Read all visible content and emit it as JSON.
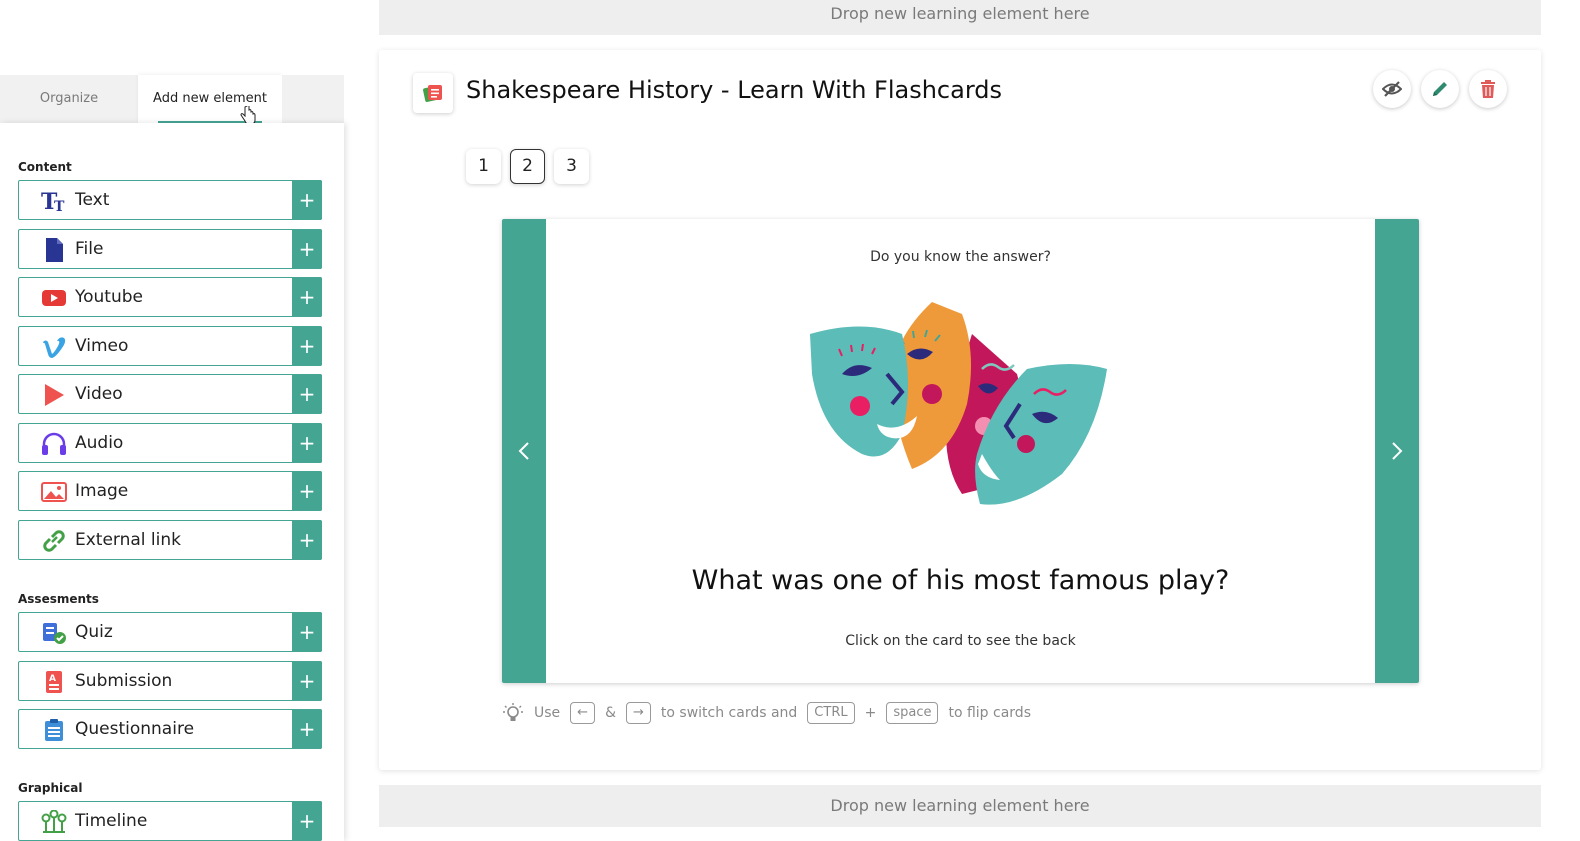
{
  "sidebar": {
    "tabs": [
      {
        "label": "Organize"
      },
      {
        "label": "Add new element"
      }
    ],
    "sections": {
      "content": {
        "title": "Content",
        "items": [
          {
            "label": "Text",
            "icon": "text-icon"
          },
          {
            "label": "File",
            "icon": "file-icon"
          },
          {
            "label": "Youtube",
            "icon": "youtube-icon"
          },
          {
            "label": "Vimeo",
            "icon": "vimeo-icon"
          },
          {
            "label": "Video",
            "icon": "video-icon"
          },
          {
            "label": "Audio",
            "icon": "headphones-icon"
          },
          {
            "label": "Image",
            "icon": "image-icon"
          },
          {
            "label": "External link",
            "icon": "link-icon"
          }
        ]
      },
      "assessments": {
        "title": "Assesments",
        "items": [
          {
            "label": "Quiz",
            "icon": "quiz-icon"
          },
          {
            "label": "Submission",
            "icon": "submission-icon"
          },
          {
            "label": "Questionnaire",
            "icon": "clipboard-icon"
          }
        ]
      },
      "graphical": {
        "title": "Graphical",
        "items": [
          {
            "label": "Timeline",
            "icon": "timeline-icon"
          }
        ]
      }
    },
    "add_symbol": "+"
  },
  "drop_zone": {
    "label": "Drop new learning element here"
  },
  "element": {
    "title": "Shakespeare History - Learn With Flashcards",
    "icon": "flashcards-icon",
    "actions": [
      "eye-off-icon",
      "pencil-icon",
      "trash-icon"
    ]
  },
  "pagination": {
    "pages": [
      "1",
      "2",
      "3"
    ],
    "current": "2"
  },
  "flashcard": {
    "prompt": "Do you know the answer?",
    "question": "What was one of his most famous play?",
    "hint": "Click on the card to see the back",
    "image": "theatre-masks-illustration"
  },
  "tips": {
    "use": "Use",
    "left_key": "←",
    "amp": "&",
    "right_key": "→",
    "switch_text": "to switch cards and",
    "ctrl_key": "CTRL",
    "plus": "+",
    "space_key": "space",
    "flip_text": "to flip cards"
  },
  "colors": {
    "accent": "#45a593",
    "delete": "#e05a5a",
    "edit": "#2e8b6f"
  }
}
